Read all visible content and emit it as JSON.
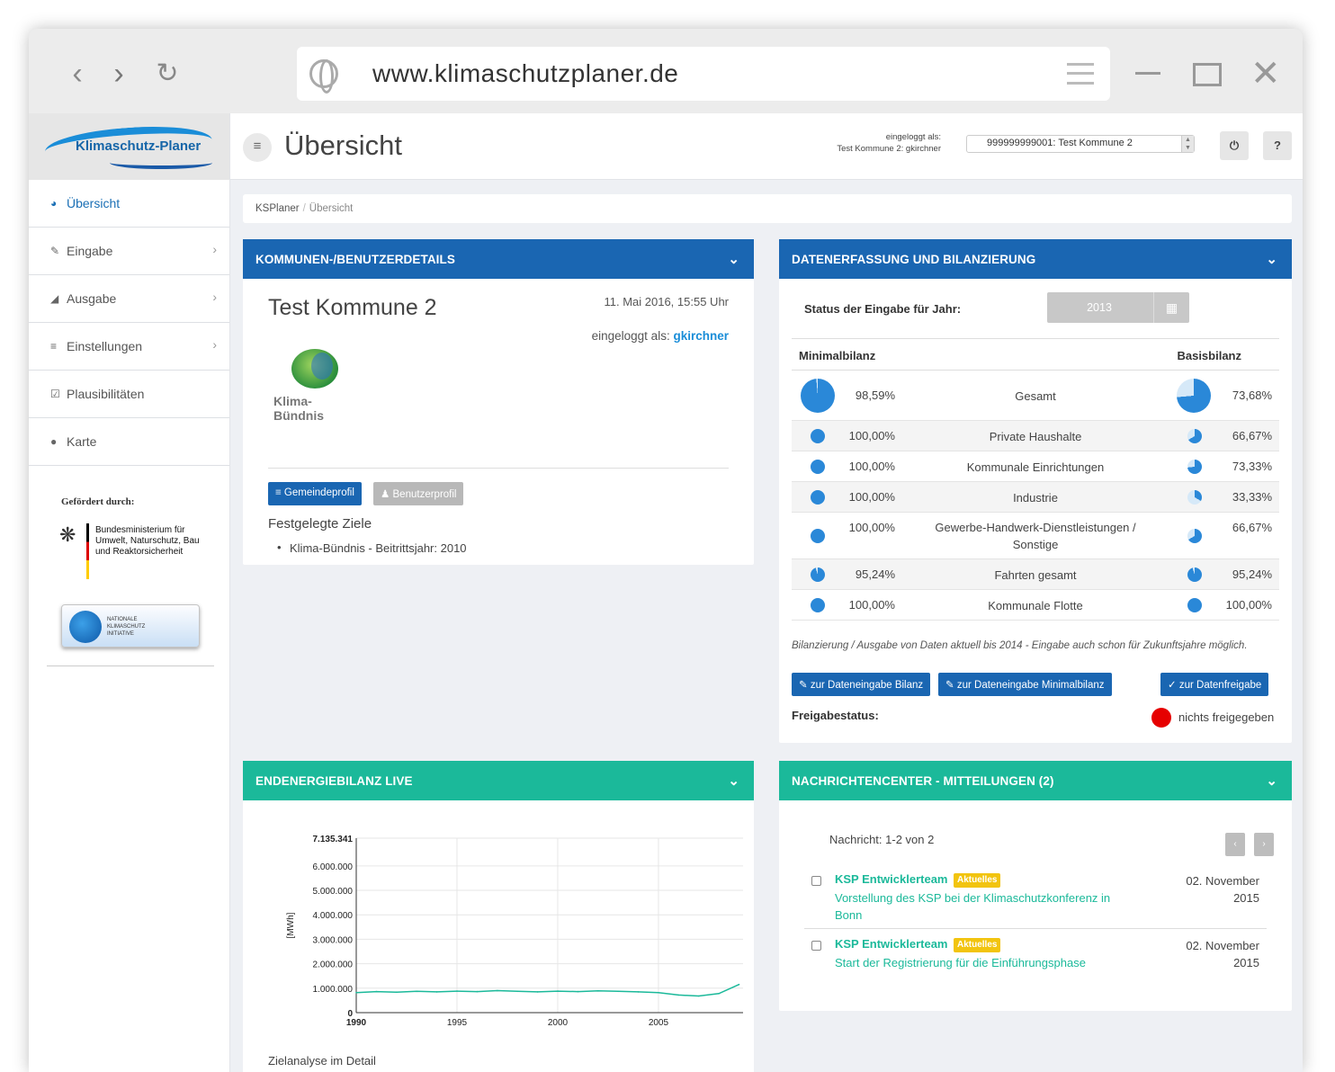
{
  "browser": {
    "url": "www.klimaschutzplaner.de",
    "back_icon": "back-arrow-icon",
    "forward_icon": "forward-arrow-icon",
    "reload_icon": "reload-icon"
  },
  "sidebar": {
    "logo_text": "Klimaschutz-Planer",
    "items": [
      {
        "label": "Übersicht",
        "icon": "dashboard-icon",
        "active": true
      },
      {
        "label": "Eingabe",
        "icon": "edit-icon",
        "has_submenu": true
      },
      {
        "label": "Ausgabe",
        "icon": "area-chart-icon",
        "has_submenu": true
      },
      {
        "label": "Einstellungen",
        "icon": "sliders-icon",
        "has_submenu": true
      },
      {
        "label": "Plausibilitäten",
        "icon": "check-square-icon"
      },
      {
        "label": "Karte",
        "icon": "globe-icon"
      }
    ],
    "funding_label": "Gefördert durch:",
    "ministry": "Bundesministerium für Umwelt, Naturschutz, Bau und Reaktorsicherheit",
    "initiative": "NATIONALE KLIMASCHUTZ INITIATIVE"
  },
  "topbar": {
    "title": "Übersicht",
    "login_label": "eingeloggt als:",
    "login_user": "Test Kommune 2: gkirchner",
    "kommune_select": "999999999001: Test Kommune 2",
    "power_icon": "power-icon",
    "help_label": "?"
  },
  "breadcrumb": {
    "root": "KSPlaner",
    "current": "Übersicht"
  },
  "kommune_panel": {
    "title": "KOMMUNEN-/BENUTZERDETAILS",
    "name": "Test Kommune 2",
    "date": "11. Mai 2016, 15:55 Uhr",
    "login_label": "eingeloggt als:",
    "login_user": "gkirchner",
    "logo_text": "Klima-Bündnis",
    "btn_gemeinde": "Gemeindeprofil",
    "btn_benutzer": "Benutzerprofil",
    "ziele_title": "Festgelegte Ziele",
    "ziele": [
      "Klima-Bündnis - Beitrittsjahr: 2010"
    ]
  },
  "daten_panel": {
    "title": "DATENERFASSUNG UND BILANZIERUNG",
    "status_label": "Status der Eingabe für Jahr:",
    "year": "2013",
    "col_left": "Minimalbilanz",
    "col_right": "Basisbilanz",
    "rows": [
      {
        "category": "Gesamt",
        "minimal": "98,59%",
        "basis": "73,68%",
        "minimal_frac": 0.9859,
        "basis_frac": 0.7368
      },
      {
        "category": "Private Haushalte",
        "minimal": "100,00%",
        "basis": "66,67%",
        "minimal_frac": 1.0,
        "basis_frac": 0.6667
      },
      {
        "category": "Kommunale Einrichtungen",
        "minimal": "100,00%",
        "basis": "73,33%",
        "minimal_frac": 1.0,
        "basis_frac": 0.7333
      },
      {
        "category": "Industrie",
        "minimal": "100,00%",
        "basis": "33,33%",
        "minimal_frac": 1.0,
        "basis_frac": 0.3333
      },
      {
        "category": "Gewerbe-Handwerk-Dienstleistungen / Sonstige",
        "minimal": "100,00%",
        "basis": "66,67%",
        "minimal_frac": 1.0,
        "basis_frac": 0.6667
      },
      {
        "category": "Fahrten gesamt",
        "minimal": "95,24%",
        "basis": "95,24%",
        "minimal_frac": 0.9524,
        "basis_frac": 0.9524
      },
      {
        "category": "Kommunale Flotte",
        "minimal": "100,00%",
        "basis": "100,00%",
        "minimal_frac": 1.0,
        "basis_frac": 1.0
      }
    ],
    "note": "Bilanzierung / Ausgabe von Daten aktuell bis 2014 - Eingabe auch schon für Zukunftsjahre möglich.",
    "btn_bilanz": "zur Dateneingabe Bilanz",
    "btn_minimal": "zur Dateneingabe Minimalbilanz",
    "btn_freigabe": "zur Datenfreigabe",
    "freigabe_label": "Freigabestatus:",
    "freigabe_value": "nichts freigegeben",
    "freigabe_color": "#e60000"
  },
  "energie_panel": {
    "title": "ENDENERGIEBILANZ LIVE",
    "footer_text": "Zielanalyse im Detail"
  },
  "chart_data": {
    "type": "line",
    "ylabel": "[MWh]",
    "xlabel": "",
    "y_ticks": [
      "0",
      "1.000.000",
      "2.000.000",
      "3.000.000",
      "4.000.000",
      "5.000.000",
      "6.000.000",
      "7.135.341"
    ],
    "y_tick_values": [
      0,
      1000000,
      2000000,
      3000000,
      4000000,
      5000000,
      6000000,
      7135341
    ],
    "x_ticks": [
      "1990",
      "1995",
      "2000",
      "2005"
    ],
    "ylim": [
      0,
      7135341
    ],
    "xlim": [
      1990,
      2009
    ],
    "grid": true,
    "series": [
      {
        "color": "#1bb99a",
        "x": [
          1990,
          1991,
          1992,
          1993,
          1994,
          1995,
          1996,
          1997,
          1998,
          1999,
          2000,
          2001,
          2002,
          2003,
          2004,
          2005,
          2006,
          2007,
          2008,
          2009
        ],
        "values": [
          820000,
          860000,
          840000,
          870000,
          850000,
          880000,
          860000,
          900000,
          870000,
          850000,
          880000,
          860000,
          890000,
          870000,
          850000,
          820000,
          720000,
          680000,
          780000,
          1150000
        ]
      }
    ]
  },
  "nachrichten_panel": {
    "title": "NACHRICHTENCENTER - MITTEILUNGEN (2)",
    "count": "Nachricht: 1-2 von 2",
    "prev": "‹",
    "next": "›",
    "messages": [
      {
        "sender": "KSP Entwicklerteam",
        "badge": "Aktuelles",
        "subject": "Vorstellung des KSP bei der Klimaschutzkonferenz in Bonn",
        "date_line1": "02. November",
        "date_line2": "2015"
      },
      {
        "sender": "KSP Entwicklerteam",
        "badge": "Aktuelles",
        "subject": "Start der Registrierung für die Einführungsphase",
        "date_line1": "02. November",
        "date_line2": "2015"
      }
    ]
  }
}
